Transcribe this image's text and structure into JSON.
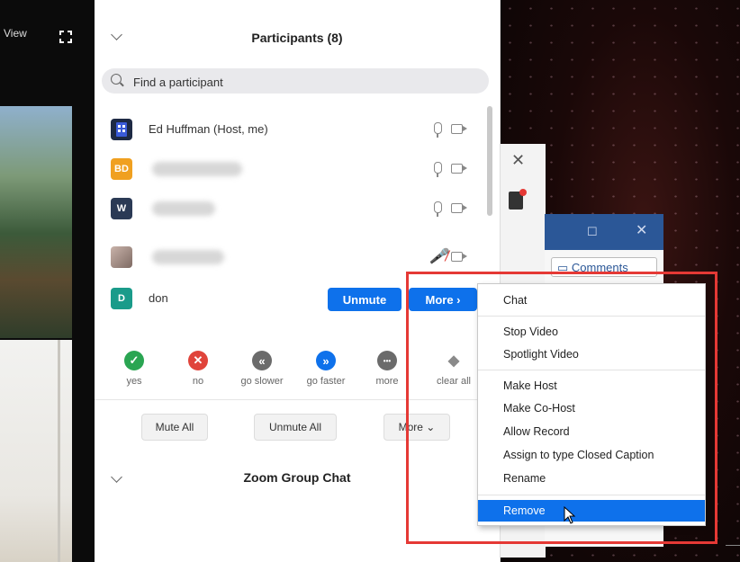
{
  "video_strip": {
    "view_label": "View"
  },
  "participants_panel": {
    "title": "Participants (8)",
    "search_placeholder": "Find a participant",
    "participants": [
      {
        "name": "Ed Huffman (Host, me)",
        "avatar_text": "",
        "avatar_color": "#1e2a44",
        "mic": "on"
      },
      {
        "name": "",
        "avatar_text": "BD",
        "avatar_color": "#f0a020",
        "mic": "on"
      },
      {
        "name": "",
        "avatar_text": "W",
        "avatar_color": "#2b3a55",
        "mic": "on"
      },
      {
        "name": "",
        "avatar_text": "",
        "avatar_color": "#a08c84",
        "mic": "muted"
      },
      {
        "name": "don",
        "avatar_text": "D",
        "avatar_color": "#1a9b8a",
        "mic": "on"
      }
    ],
    "unmute_label": "Unmute",
    "more_label": "More ›",
    "reactions": [
      {
        "label": "yes",
        "symbol": "✓",
        "color": "#2aa552"
      },
      {
        "label": "no",
        "symbol": "✕",
        "color": "#e0443b"
      },
      {
        "label": "go slower",
        "symbol": "«",
        "color": "#6b6b6b"
      },
      {
        "label": "go faster",
        "symbol": "»",
        "color": "#0e71eb"
      },
      {
        "label": "more",
        "symbol": "•••",
        "color": "#6b6b6b"
      },
      {
        "label": "clear all",
        "symbol": "◆",
        "color": "#8a8a8a"
      }
    ],
    "footer_buttons": {
      "mute_all": "Mute All",
      "unmute_all": "Unmute All",
      "more": "More ⌄"
    },
    "chat_title": "Zoom Group Chat"
  },
  "context_menu": {
    "items": [
      "Chat",
      "Stop Video",
      "Spotlight Video",
      "Make Host",
      "Make Co-Host",
      "Allow Record",
      "Assign to type Closed Caption",
      "Rename",
      "Remove"
    ],
    "highlighted": "Remove"
  },
  "background_app": {
    "comments_label": "Comments"
  },
  "colors": {
    "accent": "#0e71eb",
    "highlight_box": "#e53935"
  }
}
